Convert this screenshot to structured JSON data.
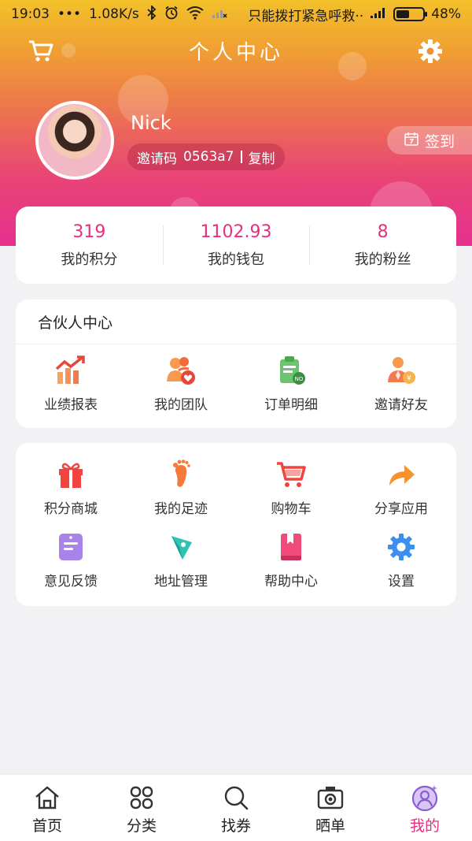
{
  "status_bar": {
    "time": "19:03",
    "dots": "•••",
    "speed": "1.08K/s",
    "carrier_text": "只能拨打紧急呼救··",
    "battery": "48%",
    "battery_level": 0.48
  },
  "header": {
    "title": "个人中心",
    "left_icon": "cart-icon",
    "right_icon": "gear-icon"
  },
  "profile": {
    "name": "Nick",
    "invite_label": "邀请码",
    "invite_code": "0563a7",
    "copy_label": "复制",
    "checkin_label": "签到"
  },
  "stats": [
    {
      "value": "319",
      "label": "我的积分"
    },
    {
      "value": "1102.93",
      "label": "我的钱包"
    },
    {
      "value": "8",
      "label": "我的粉丝"
    }
  ],
  "partner_center": {
    "title": "合伙人中心",
    "items": [
      {
        "label": "业绩报表",
        "icon": "chart-icon"
      },
      {
        "label": "我的团队",
        "icon": "team-icon"
      },
      {
        "label": "订单明细",
        "icon": "order-icon"
      },
      {
        "label": "邀请好友",
        "icon": "invite-icon"
      }
    ]
  },
  "tools": {
    "row1": [
      {
        "label": "积分商城",
        "icon": "gift-icon"
      },
      {
        "label": "我的足迹",
        "icon": "footprint-icon"
      },
      {
        "label": "购物车",
        "icon": "shopping-cart-icon"
      },
      {
        "label": "分享应用",
        "icon": "share-icon"
      }
    ],
    "row2": [
      {
        "label": "意见反馈",
        "icon": "feedback-icon"
      },
      {
        "label": "地址管理",
        "icon": "address-icon"
      },
      {
        "label": "帮助中心",
        "icon": "help-book-icon"
      },
      {
        "label": "设置",
        "icon": "settings-icon"
      }
    ]
  },
  "tab_bar": [
    {
      "label": "首页",
      "icon": "home-icon"
    },
    {
      "label": "分类",
      "icon": "category-icon"
    },
    {
      "label": "找券",
      "icon": "search-icon"
    },
    {
      "label": "晒单",
      "icon": "camera-icon"
    },
    {
      "label": "我的",
      "icon": "profile-icon",
      "active": true
    }
  ],
  "colors": {
    "accent": "#e5307f",
    "header_gradient_top": "#f3c12a",
    "header_gradient_bottom": "#e5308f"
  }
}
